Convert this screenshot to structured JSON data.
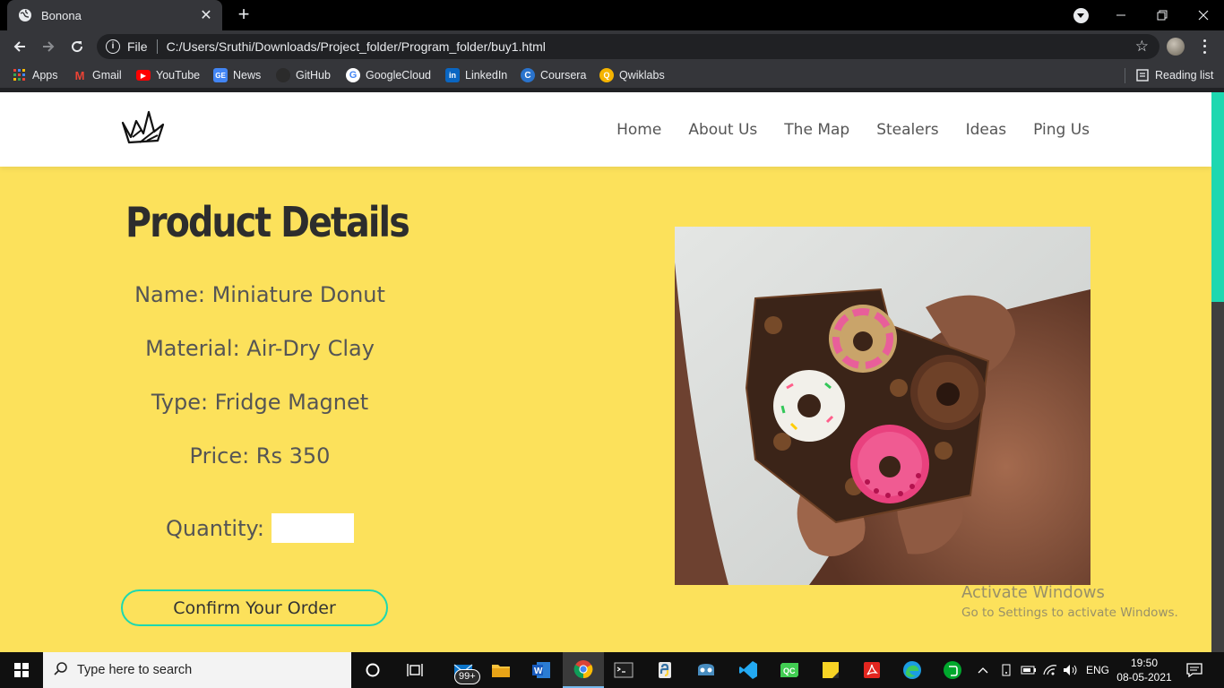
{
  "browser": {
    "tab_title": "Bonona",
    "url_scheme": "File",
    "url": "C:/Users/Sruthi/Downloads/Project_folder/Program_folder/buy1.html",
    "bookmarks": [
      "Apps",
      "Gmail",
      "YouTube",
      "News",
      "GitHub",
      "GoogleCloud",
      "LinkedIn",
      "Coursera",
      "Qwiklabs"
    ],
    "reading_list": "Reading list"
  },
  "site": {
    "nav": [
      "Home",
      "About Us",
      "The Map",
      "Stealers",
      "Ideas",
      "Ping Us"
    ]
  },
  "product": {
    "heading": "Product Details",
    "name": "Name: Miniature Donut",
    "material": "Material: Air-Dry Clay",
    "type": "Type: Fridge Magnet",
    "price": "Price: Rs 350",
    "quantity_label": "Quantity:",
    "quantity_value": "",
    "confirm_label": "Confirm Your Order"
  },
  "watermark": {
    "line1": "Activate Windows",
    "line2": "Go to Settings to activate Windows."
  },
  "taskbar": {
    "search_placeholder": "Type here to search",
    "badge": "99+",
    "language": "ENG",
    "time": "19:50",
    "date": "08-05-2021"
  },
  "colors": {
    "page_bg": "#fce15b",
    "accent": "#1dd8b0",
    "header_bg": "#ffffff",
    "text_dark": "#2d2d2d",
    "text_body": "#555555"
  }
}
